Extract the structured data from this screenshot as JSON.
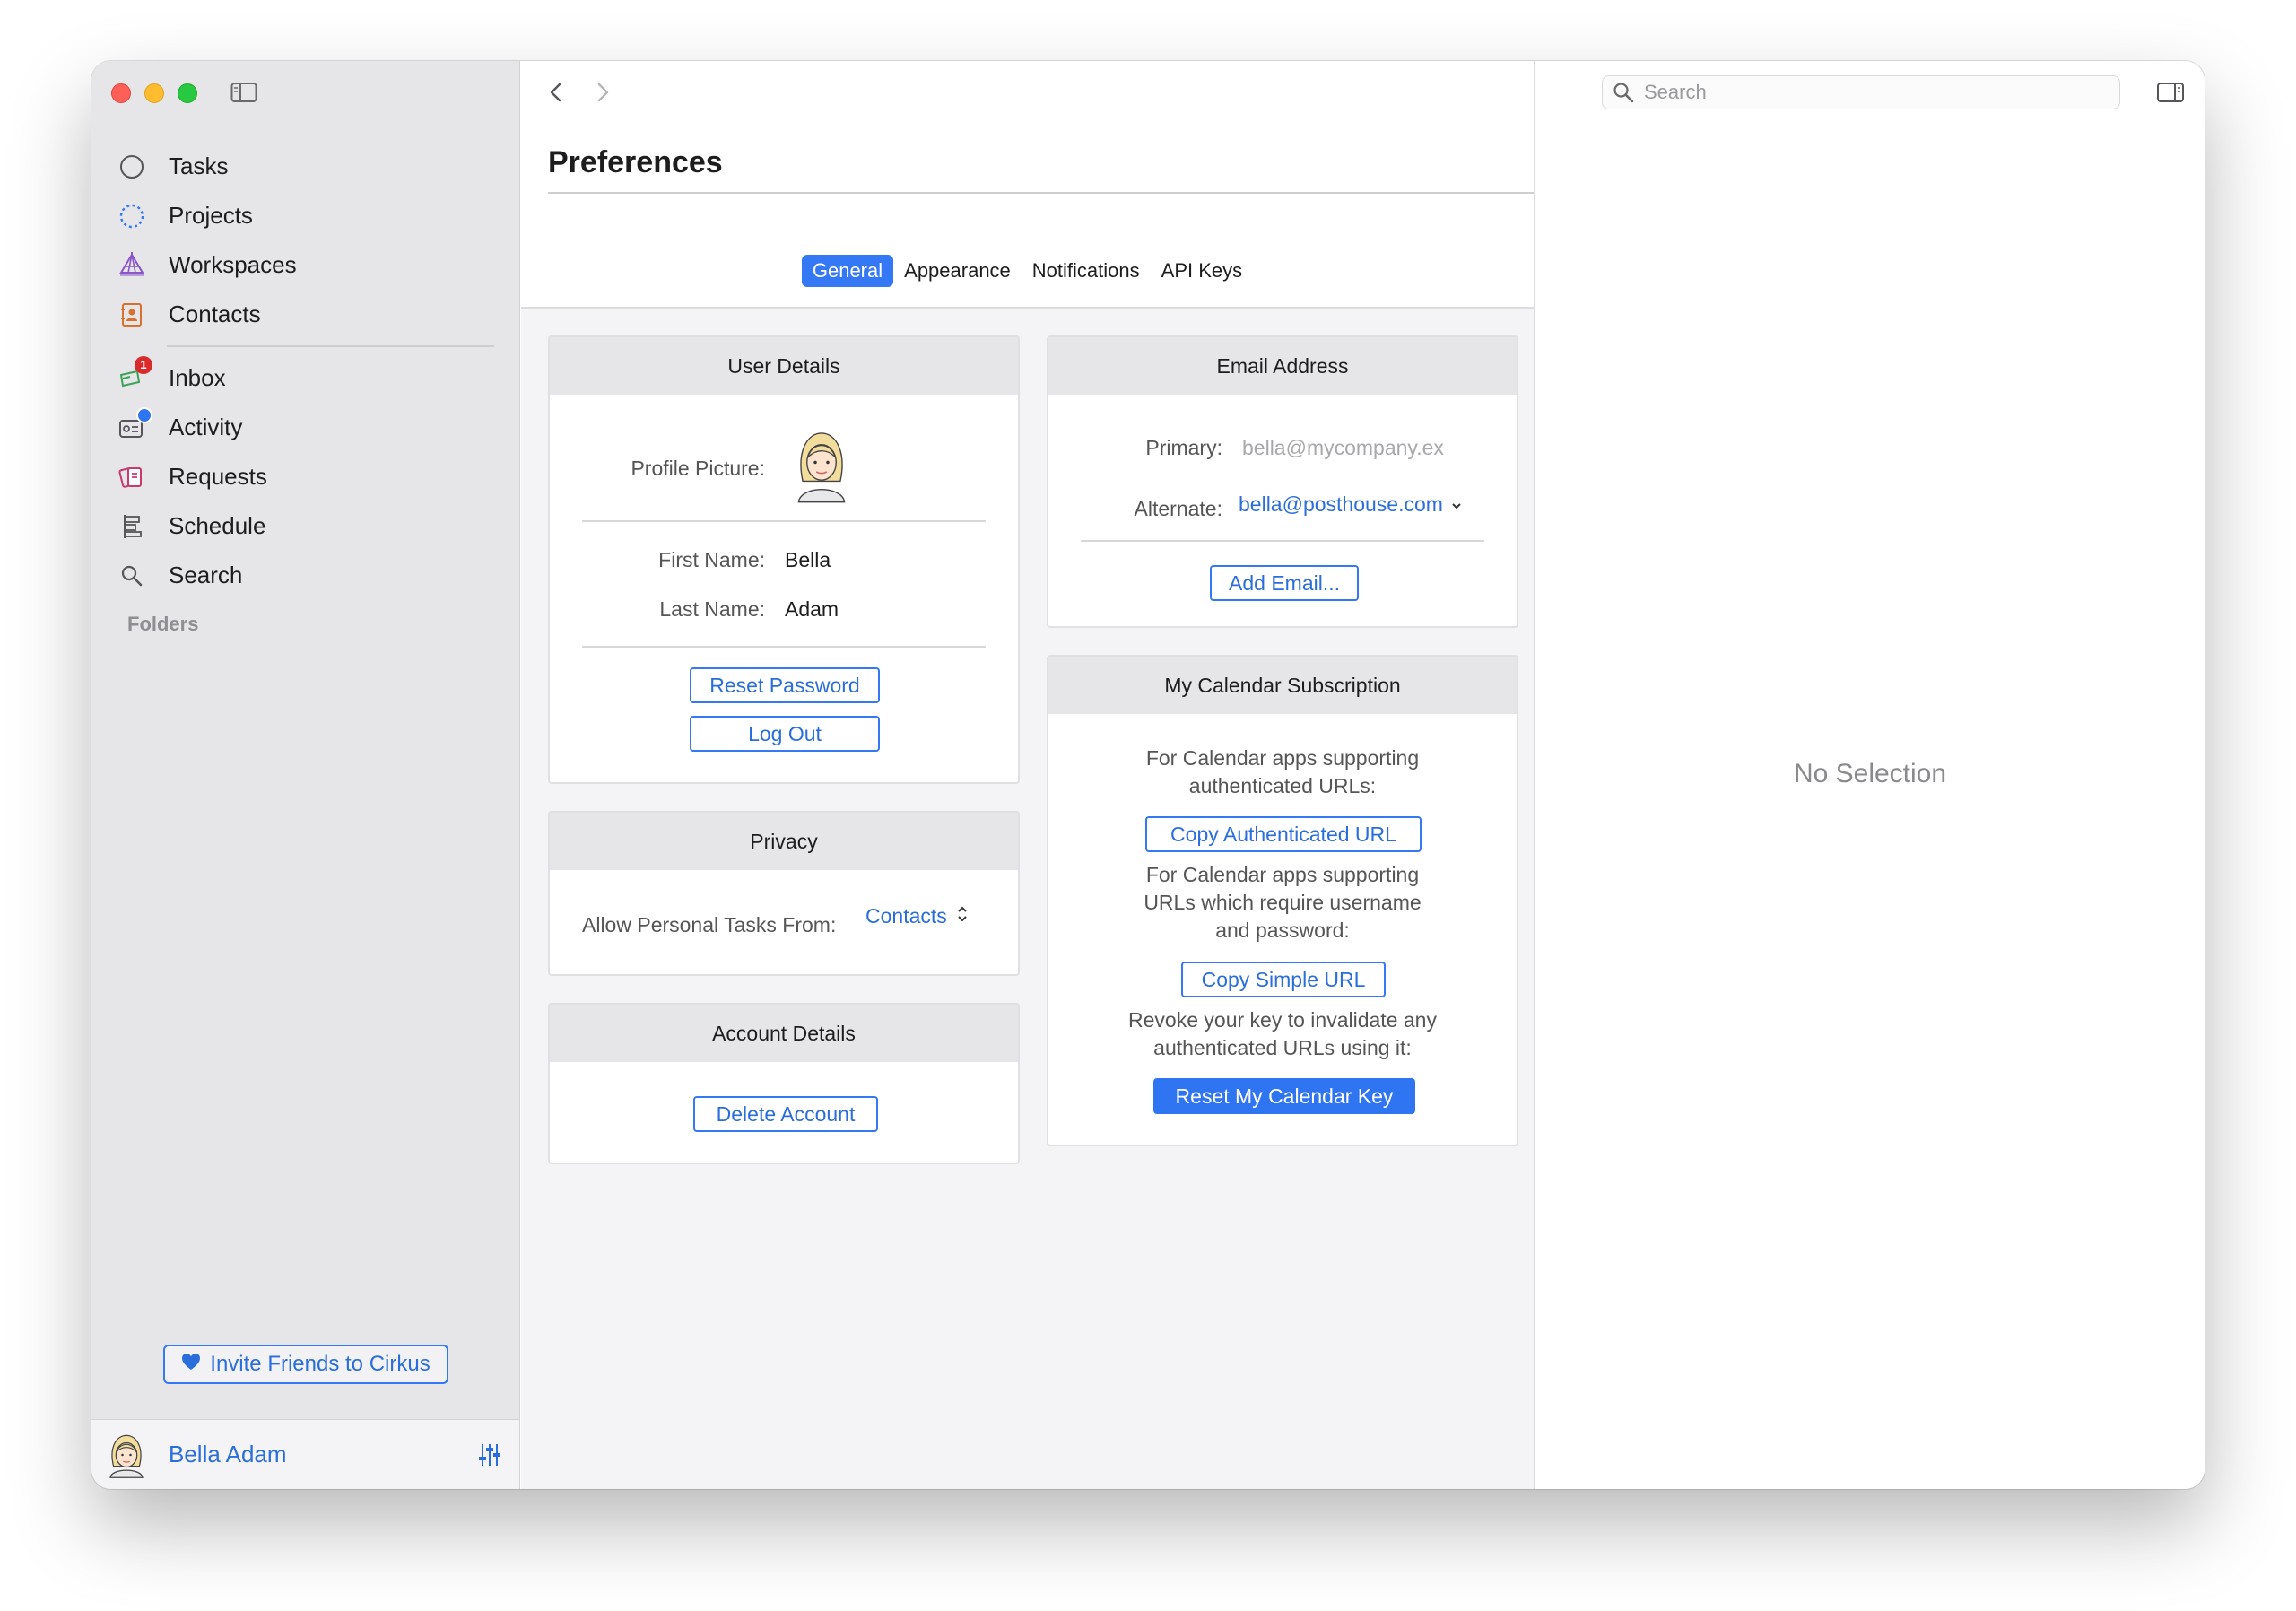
{
  "sidebar": {
    "items": [
      {
        "label": "Tasks",
        "icon": "circle-icon"
      },
      {
        "label": "Projects",
        "icon": "dotted-circle-icon"
      },
      {
        "label": "Workspaces",
        "icon": "tent-icon"
      },
      {
        "label": "Contacts",
        "icon": "contact-book-icon"
      },
      {
        "label": "Inbox",
        "icon": "inbox-icon",
        "badge": "1"
      },
      {
        "label": "Activity",
        "icon": "activity-icon"
      },
      {
        "label": "Requests",
        "icon": "requests-icon"
      },
      {
        "label": "Schedule",
        "icon": "schedule-icon"
      },
      {
        "label": "Search",
        "icon": "search-icon"
      }
    ],
    "folders_label": "Folders",
    "invite_label": "Invite Friends to Cirkus",
    "user_name": "Bella Adam"
  },
  "main": {
    "title": "Preferences",
    "tabs": [
      "General",
      "Appearance",
      "Notifications",
      "API Keys"
    ],
    "active_tab": "General"
  },
  "user_details": {
    "heading": "User Details",
    "profile_picture_label": "Profile Picture:",
    "first_name_label": "First Name:",
    "first_name": "Bella",
    "last_name_label": "Last Name:",
    "last_name": "Adam",
    "reset_password": "Reset Password",
    "log_out": "Log Out"
  },
  "privacy": {
    "heading": "Privacy",
    "allow_label": "Allow Personal Tasks From:",
    "allow_value": "Contacts"
  },
  "account_details": {
    "heading": "Account Details",
    "delete_account": "Delete Account"
  },
  "email": {
    "heading": "Email Address",
    "primary_label": "Primary:",
    "primary_value": "bella@mycompany.ex",
    "alternate_label": "Alternate:",
    "alternate_value": "bella@posthouse.com",
    "add_email": "Add Email..."
  },
  "calendar": {
    "heading": "My Calendar Subscription",
    "text1_line1": "For Calendar apps supporting",
    "text1_line2": "authenticated URLs:",
    "copy_auth": "Copy Authenticated URL",
    "text2_line1": "For Calendar apps supporting",
    "text2_line2": "URLs which require username",
    "text2_line3": "and password:",
    "copy_simple": "Copy Simple URL",
    "text3_line1": "Revoke your key to invalidate any",
    "text3_line2": "authenticated URLs using it:",
    "reset_key": "Reset My Calendar Key"
  },
  "inspector": {
    "search_placeholder": "Search",
    "empty_text": "No Selection"
  },
  "colors": {
    "accent": "#3478f6",
    "sidebar_bg": "#e6e6e8",
    "badge_red": "#d92b2b",
    "badge_blue": "#2f74f0"
  }
}
